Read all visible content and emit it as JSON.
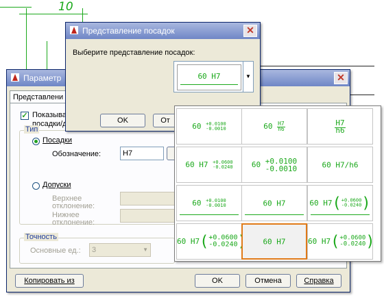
{
  "dimension_value": "10",
  "params_dialog": {
    "title": "Параметр",
    "tab_label": "Представлени",
    "show_checkbox_line1": "Показыва",
    "show_checkbox_line2": "посадки/д",
    "type_group": "Тип",
    "radio_fits": "Посадки",
    "designation_label": "Обозначение:",
    "designation_value": "H7",
    "radio_tolerances": "Допуски",
    "upper_dev_label_1": "Верхнее",
    "upper_dev_label_2": "отклонение:",
    "lower_dev_label_1": "Нижнее",
    "lower_dev_label_2": "отклонение:",
    "precision_group": "Точность",
    "primary_units_label": "Основные ед.:",
    "primary_units_value": "3",
    "copy_from_button": "Копировать из",
    "ok_button": "OK",
    "cancel_button": "Отмена",
    "help_button": "Справка"
  },
  "fit_dialog": {
    "title": "Представление посадок",
    "prompt": "Выберите представление посадок:",
    "selected_preview": "60 H7",
    "ok_button": "OK",
    "cancel_button": "От"
  },
  "fit_options": [
    {
      "base": "60",
      "upper": "+0.0100",
      "lower": "-0.0010"
    },
    {
      "base": "60",
      "num": "H7",
      "den": "h6"
    },
    {
      "base": "",
      "num": "H7",
      "den": "h6"
    },
    {
      "base": "60 H7",
      "upper": "+0.0600",
      "lower": "-0.0240"
    },
    {
      "base": "60",
      "upper": "+0.0100",
      "lower": "-0.0010"
    },
    {
      "base": "60 H7/h6"
    },
    {
      "base": "60",
      "upper": "+0.0100",
      "lower": "-0.0010"
    },
    {
      "base": "60 H7"
    },
    {
      "base": "60 H7",
      "upper": "+0.0600",
      "lower": "-0.0240"
    },
    {
      "base": "60 H7",
      "upper": "+0.0600",
      "lower": "-0.0240"
    },
    {
      "base": "60 H7"
    },
    {
      "base": "60 H7",
      "upper": "+0.0600",
      "lower": "-0.0240"
    }
  ]
}
